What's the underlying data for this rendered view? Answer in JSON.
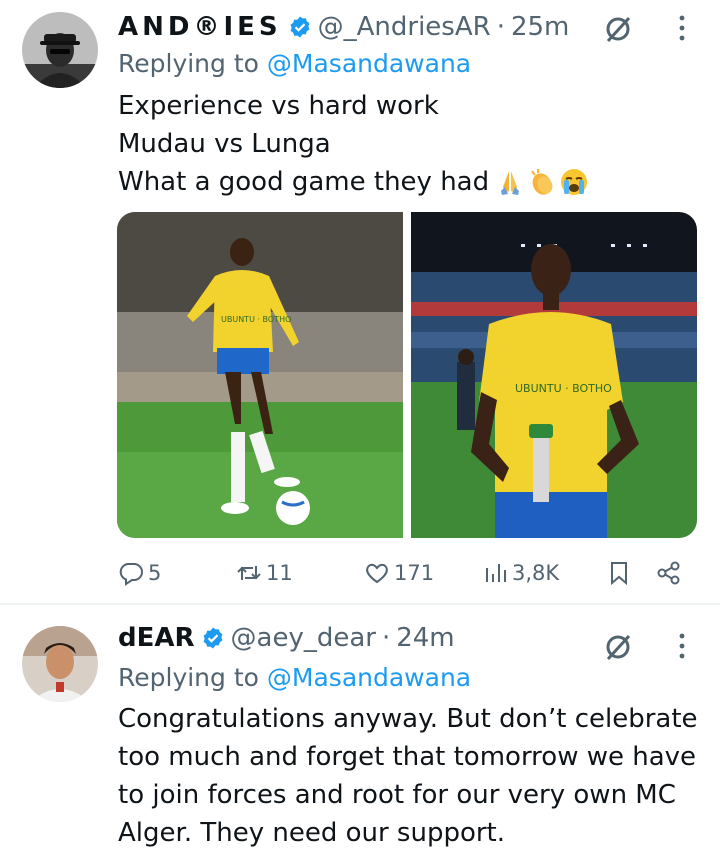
{
  "tweets": [
    {
      "display_name": "AND®IES",
      "handle": "@_AndriesAR",
      "separator": "·",
      "time": "25m",
      "replying_prefix": "Replying to",
      "replying_to": "@Masandawana",
      "body_lines": [
        "Experience vs hard work",
        "Mudau vs Lunga",
        "What a good game they had"
      ],
      "emojis": [
        "folded-hands",
        "clapping-hands",
        "loudly-crying-face"
      ],
      "media": [
        {
          "type": "photo",
          "kit_text": "UBUNTU · BOTHO"
        },
        {
          "type": "photo",
          "kit_text": "UBUNTU · BOTHO"
        }
      ],
      "actions": {
        "replies": "5",
        "reposts": "11",
        "likes": "171",
        "views": "3,8K"
      }
    },
    {
      "display_name": "dEAR",
      "handle": "@aey_dear",
      "separator": "·",
      "time": "24m",
      "replying_prefix": "Replying to",
      "replying_to": "@Masandawana",
      "body_lines": [
        "Congratulations anyway. But don’t celebrate",
        "too much and forget that tomorrow we have",
        "to join forces and root for our very own MC",
        "Alger. They need our support."
      ]
    }
  ],
  "colors": {
    "text": "#0f1419",
    "secondary": "#536471",
    "accent": "#1d9bf0",
    "divider": "#eff3f4"
  },
  "icons": [
    "verified-badge-icon",
    "grok-icon",
    "more-icon",
    "reply-icon",
    "repost-icon",
    "like-icon",
    "views-icon",
    "bookmark-icon",
    "share-icon"
  ]
}
